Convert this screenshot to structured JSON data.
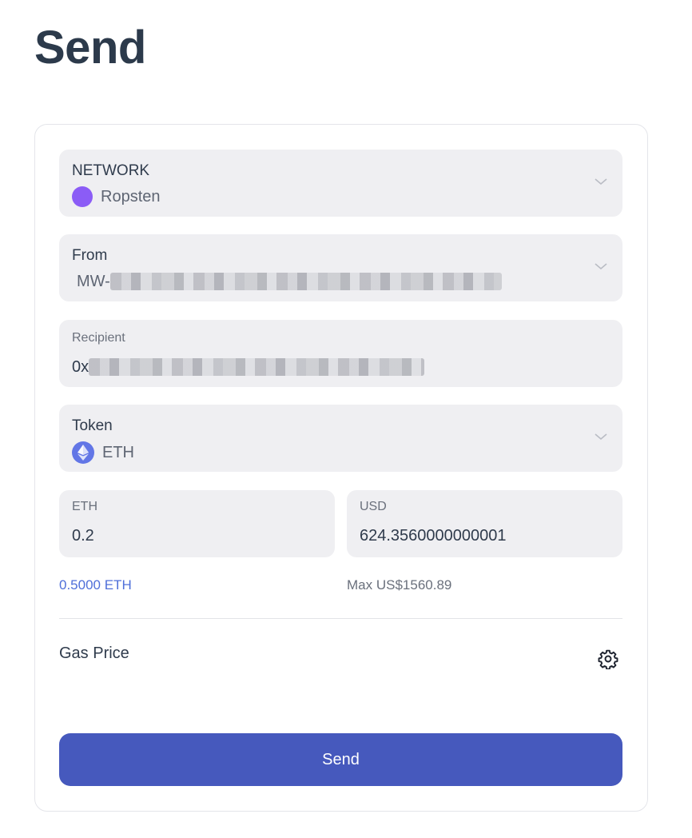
{
  "page": {
    "title": "Send"
  },
  "network": {
    "label": "NETWORK",
    "value": "Ropsten",
    "dot_color": "#8b5cf6",
    "icon": "network-dot-icon"
  },
  "from": {
    "label": "From",
    "prefix": "MW-"
  },
  "recipient": {
    "label": "Recipient",
    "prefix": "0x"
  },
  "token": {
    "label": "Token",
    "value": "ETH",
    "icon": "eth-icon"
  },
  "amount": {
    "eth_label": "ETH",
    "eth_value": "0.2",
    "usd_label": "USD",
    "usd_value": "624.3560000000001",
    "balance": "0.5000 ETH",
    "max": "Max US$1560.89"
  },
  "gas": {
    "label": "Gas Price",
    "icon": "gear-icon"
  },
  "actions": {
    "send_label": "Send",
    "send_color": "#4659bd"
  }
}
